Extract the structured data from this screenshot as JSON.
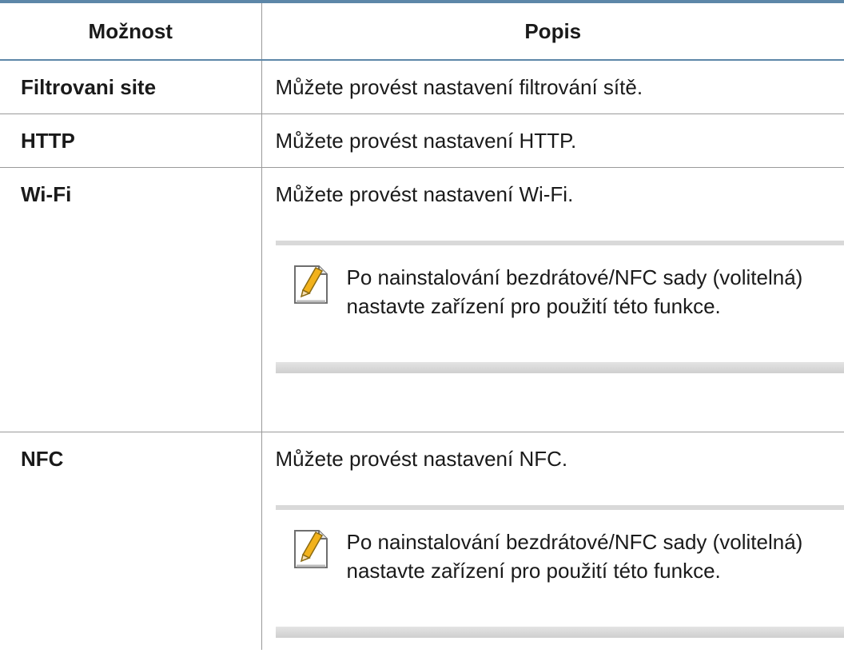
{
  "table": {
    "header": {
      "option": "Možnost",
      "description": "Popis"
    },
    "rows": [
      {
        "name": "Filtrovani site",
        "description": "Můžete provést nastavení filtrování sítě."
      },
      {
        "name": "HTTP",
        "description": "Můžete provést nastavení HTTP."
      },
      {
        "name": "Wi-Fi",
        "description": "Můžete provést nastavení Wi-Fi.",
        "note": {
          "icon": "note-pencil-icon",
          "text": "Po nainstalování bezdrátové/NFC sady (volitelná) nastavte zařízení pro použití této funkce."
        }
      },
      {
        "name": "NFC",
        "description": "Můžete provést nastavení NFC.",
        "note": {
          "icon": "note-pencil-icon",
          "text": "Po nainstalování bezdrátové/NFC sady (volitelná) nastavte zařízení pro použití této funkce."
        }
      }
    ]
  },
  "colors": {
    "rule": "#5d87a8",
    "grid": "#9a9a9a",
    "note_shade": "#d9d9d9",
    "pencil": "#f2b21c"
  }
}
